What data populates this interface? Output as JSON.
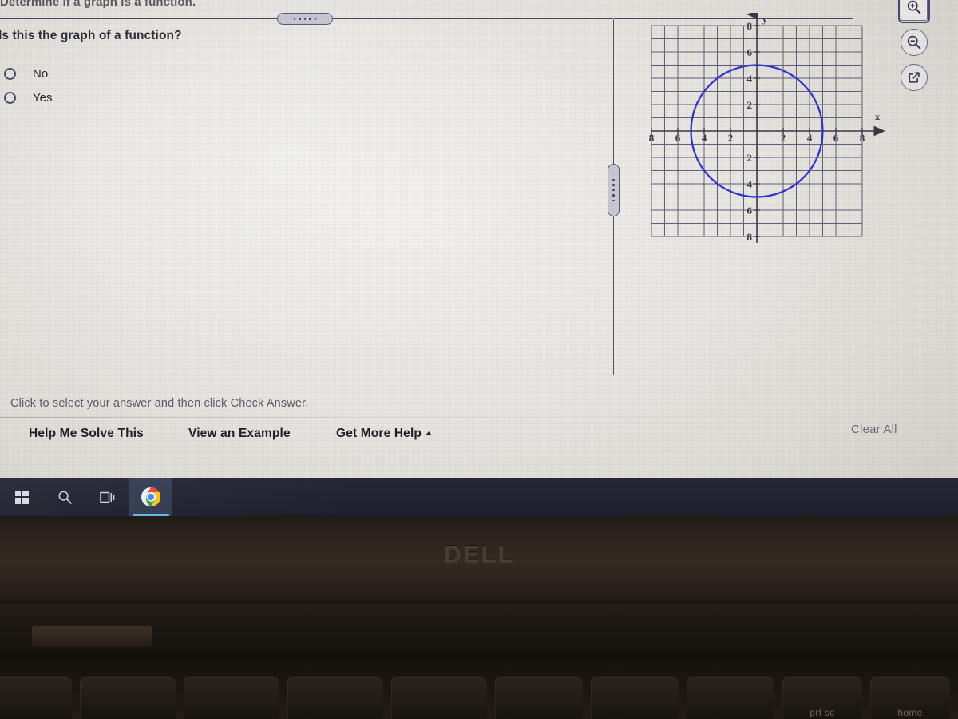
{
  "header": {
    "title": "Determine if a graph is a function."
  },
  "question": {
    "prompt": "Is this the graph of a function?",
    "choices": [
      {
        "label": "No",
        "selected": false
      },
      {
        "label": "Yes",
        "selected": false
      }
    ]
  },
  "instruction": "Click to select your answer and then click Check Answer.",
  "footer": {
    "help_me_solve_this": "Help Me Solve This",
    "view_an_example": "View an Example",
    "get_more_help": "Get More Help",
    "get_more_help_caret": "caret-up-icon",
    "clear_all": "Clear All"
  },
  "tools": [
    {
      "name": "zoom-in-icon",
      "selected": true
    },
    {
      "name": "zoom-out-icon",
      "selected": false
    },
    {
      "name": "open-in-new-window-icon",
      "selected": false
    }
  ],
  "splitters": {
    "horizontal_handle": "horizontal-splitter-handle",
    "vertical_handle": "vertical-splitter-handle",
    "dot_count": 5
  },
  "colors": {
    "curve": "#2f35cf",
    "grid": "#5b5470",
    "axis": "#3a3748",
    "screen_bg": "#e9e7e2",
    "taskbar": "#1d1f2d",
    "accent_selected": "#4a4878"
  },
  "chart_data": {
    "type": "scatter",
    "title": "",
    "xlabel": "x",
    "ylabel": "y",
    "xlim": [
      -8,
      8
    ],
    "ylim": [
      -8,
      8
    ],
    "grid": true,
    "grid_step": 1,
    "legend": false,
    "x_ticks": [
      -8,
      -6,
      -4,
      -2,
      2,
      4,
      6,
      8
    ],
    "y_ticks": [
      -8,
      -6,
      -4,
      -2,
      2,
      4,
      6,
      8
    ],
    "x_tick_labels": [
      "8",
      "6",
      "4",
      "2",
      "2",
      "4",
      "6",
      "8"
    ],
    "y_tick_labels": [
      "8",
      "6",
      "4",
      "2",
      "2",
      "4",
      "6",
      "8"
    ],
    "series": [
      {
        "name": "circle",
        "shape": "circle",
        "center": [
          0,
          0
        ],
        "radius": 5,
        "color": "#2f35cf",
        "linewidth": 2,
        "equation": "x^2 + y^2 = 25"
      }
    ],
    "annotation": "A circle of radius 5 centered at the origin; fails the vertical line test."
  },
  "taskbar": {
    "items": [
      {
        "name": "start-button",
        "icon": "windows-logo-icon",
        "active": false
      },
      {
        "name": "search-button",
        "icon": "search-icon",
        "active": false
      },
      {
        "name": "task-view-button",
        "icon": "task-view-icon",
        "active": false
      },
      {
        "name": "chrome-button",
        "icon": "chrome-icon",
        "active": true
      }
    ]
  },
  "laptop": {
    "brand": "DELL",
    "keys": [
      {
        "label": "prt sc"
      },
      {
        "label": "home"
      }
    ]
  }
}
